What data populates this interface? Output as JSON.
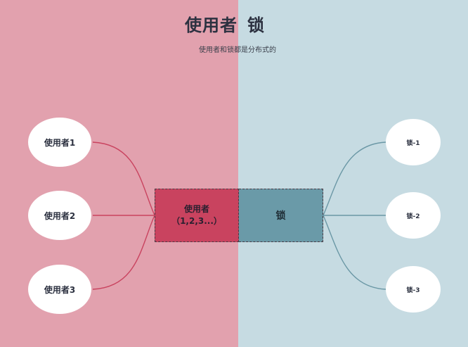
{
  "title": {
    "part1": "使用者",
    "part2": "锁"
  },
  "subtitle": "使用者和锁都是分布式的",
  "center": {
    "users_label": "使用者",
    "users_range": "（1,2,3...）",
    "lock_label": "锁"
  },
  "users": [
    {
      "label": "使用者1"
    },
    {
      "label": "使用者2"
    },
    {
      "label": "使用者3"
    }
  ],
  "locks": [
    {
      "label": "锁-1"
    },
    {
      "label": "锁-2"
    },
    {
      "label": "锁-3"
    }
  ],
  "colors": {
    "left_panel": "#e2a1ae",
    "right_panel": "#c6dbe2",
    "users_box": "#c9435f",
    "lock_box": "#6a9aa8",
    "user_link": "#c9435f",
    "lock_link": "#6a97a5"
  }
}
